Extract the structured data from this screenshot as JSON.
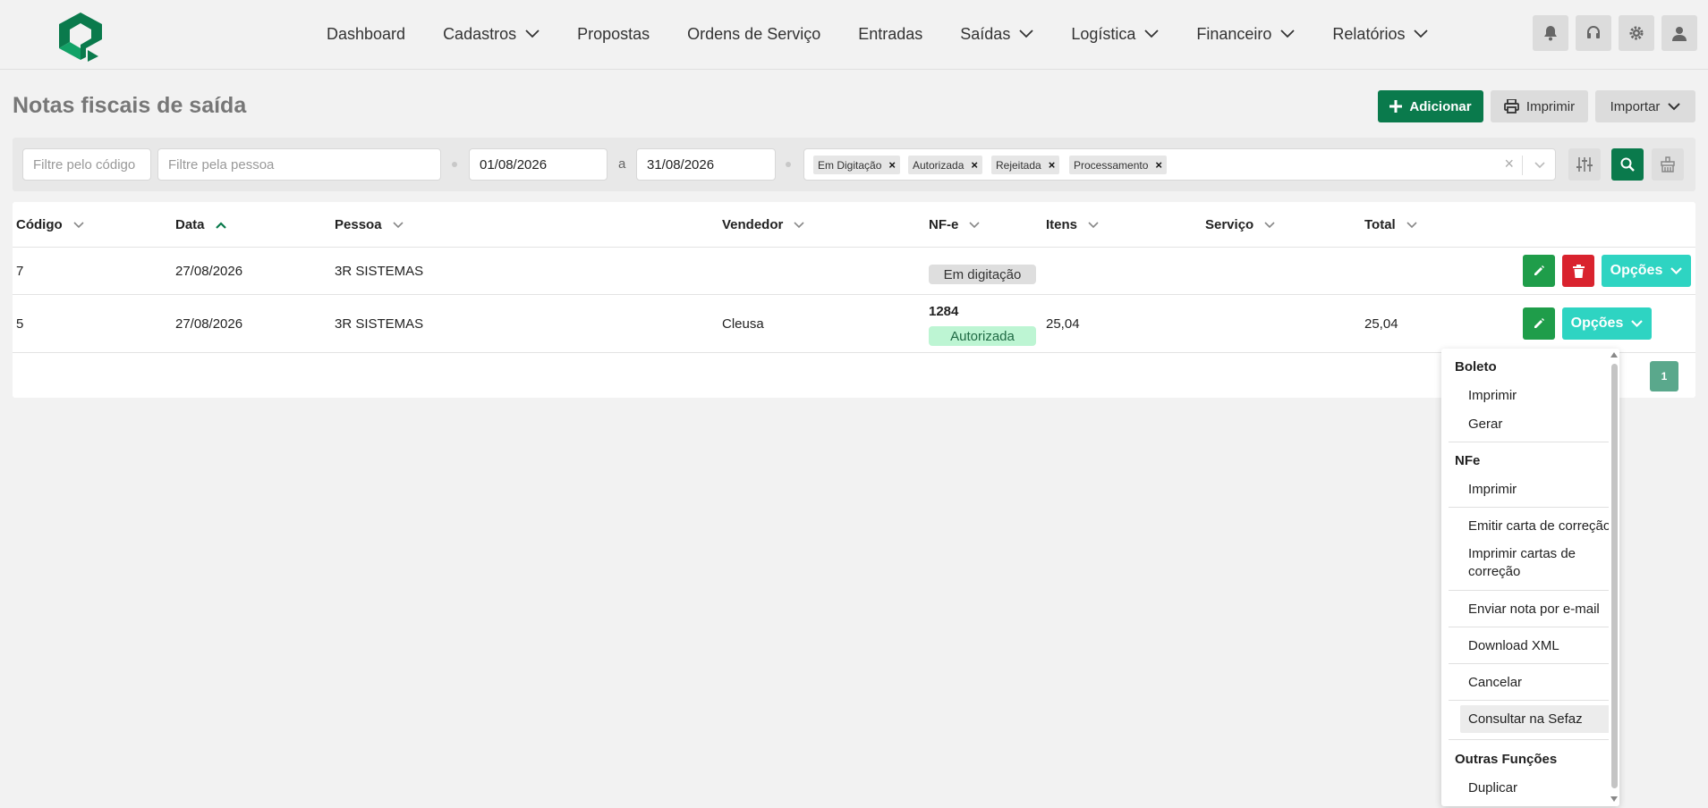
{
  "nav": {
    "items": [
      {
        "label": "Dashboard",
        "dropdown": false
      },
      {
        "label": "Cadastros",
        "dropdown": true
      },
      {
        "label": "Propostas",
        "dropdown": false
      },
      {
        "label": "Ordens de Serviço",
        "dropdown": false
      },
      {
        "label": "Entradas",
        "dropdown": false
      },
      {
        "label": "Saídas",
        "dropdown": true
      },
      {
        "label": "Logística",
        "dropdown": true
      },
      {
        "label": "Financeiro",
        "dropdown": true
      },
      {
        "label": "Relatórios",
        "dropdown": true
      }
    ],
    "icons": [
      "bell-icon",
      "headset-icon",
      "gear-icon",
      "user-icon"
    ]
  },
  "page": {
    "title": "Notas fiscais de saída",
    "add_label": "Adicionar",
    "print_label": "Imprimir",
    "import_label": "Importar"
  },
  "filters": {
    "code_placeholder": "Filtre pelo código",
    "person_placeholder": "Filtre pela pessoa",
    "date_from": "01/08/2026",
    "date_sep": "a",
    "date_to": "31/08/2026",
    "status_tags": [
      "Em Digitação",
      "Autorizada",
      "Rejeitada",
      "Processamento"
    ]
  },
  "table": {
    "columns": [
      "Código",
      "Data",
      "Pessoa",
      "Vendedor",
      "NF-e",
      "Itens",
      "Serviço",
      "Total"
    ],
    "sorted_column": "Data",
    "rows": [
      {
        "codigo": "7",
        "data": "27/08/2026",
        "pessoa": "3R SISTEMAS",
        "vendedor": "",
        "nfe_number": "",
        "nfe_status": "Em digitação",
        "itens": "",
        "servico": "",
        "total": ""
      },
      {
        "codigo": "5",
        "data": "27/08/2026",
        "pessoa": "3R SISTEMAS",
        "vendedor": "Cleusa",
        "nfe_number": "1284",
        "nfe_status": "Autorizada",
        "itens": "25,04",
        "servico": "",
        "total": "25,04"
      }
    ],
    "options_label": "Opções",
    "page": "1"
  },
  "menu": {
    "sections": [
      {
        "heading": "Boleto",
        "items": [
          "Imprimir",
          "Gerar"
        ]
      },
      {
        "heading": "NFe",
        "items": [
          "Imprimir"
        ]
      },
      {
        "heading": "",
        "items": [
          "Emitir carta de correção",
          "Imprimir cartas de correção"
        ]
      },
      {
        "heading": "",
        "items": [
          "Enviar nota por e-mail"
        ]
      },
      {
        "heading": "",
        "items": [
          "Download XML"
        ]
      },
      {
        "heading": "",
        "items": [
          "Cancelar"
        ]
      },
      {
        "heading": "",
        "items": [
          "Consultar na Sefaz"
        ]
      },
      {
        "heading": "Outras Funções",
        "items": [
          "Duplicar"
        ]
      }
    ],
    "hovered_item": "Consultar na Sefaz"
  },
  "colors": {
    "brand": "#0a7a4c",
    "edit": "#1f9d4a",
    "delete": "#d9232e",
    "options": "#2ed4c2",
    "status_authorized_bg": "#bdf5d3",
    "status_draft_bg": "#dedede"
  }
}
